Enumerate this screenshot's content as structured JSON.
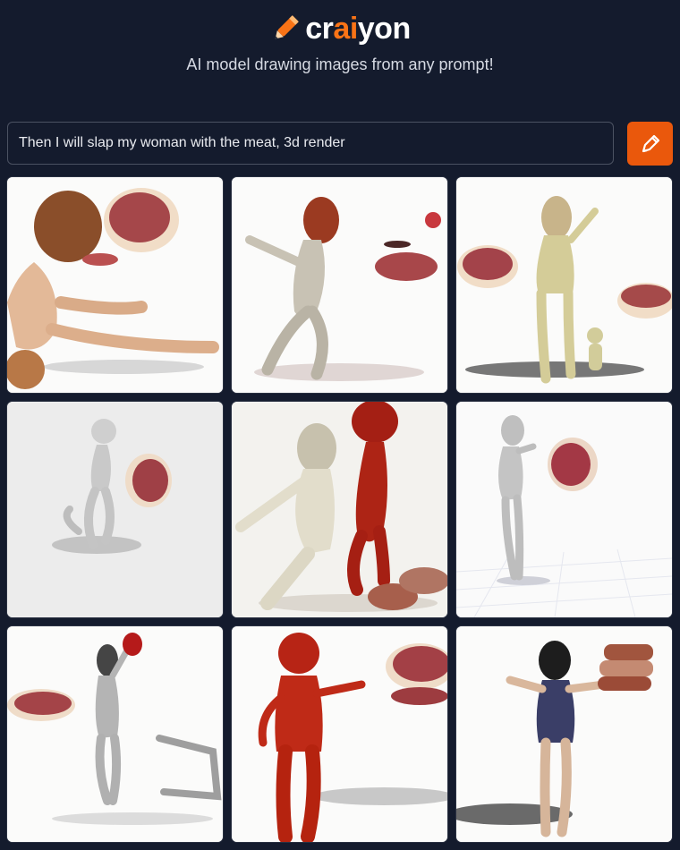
{
  "header": {
    "logo_prefix": "cr",
    "logo_accent": "ai",
    "logo_suffix": "yon",
    "tagline": "AI model drawing images from any prompt!"
  },
  "prompt": {
    "value": "Then I will slap my woman with the meat, 3d render"
  },
  "draw_button": {
    "icon": "pencil-icon"
  },
  "colors": {
    "background": "#141b2d",
    "accent": "#f97316",
    "button": "#ea580c"
  },
  "results": [
    {
      "id": 1,
      "alt": "generated image 1"
    },
    {
      "id": 2,
      "alt": "generated image 2"
    },
    {
      "id": 3,
      "alt": "generated image 3"
    },
    {
      "id": 4,
      "alt": "generated image 4"
    },
    {
      "id": 5,
      "alt": "generated image 5"
    },
    {
      "id": 6,
      "alt": "generated image 6"
    },
    {
      "id": 7,
      "alt": "generated image 7"
    },
    {
      "id": 8,
      "alt": "generated image 8"
    },
    {
      "id": 9,
      "alt": "generated image 9"
    }
  ]
}
